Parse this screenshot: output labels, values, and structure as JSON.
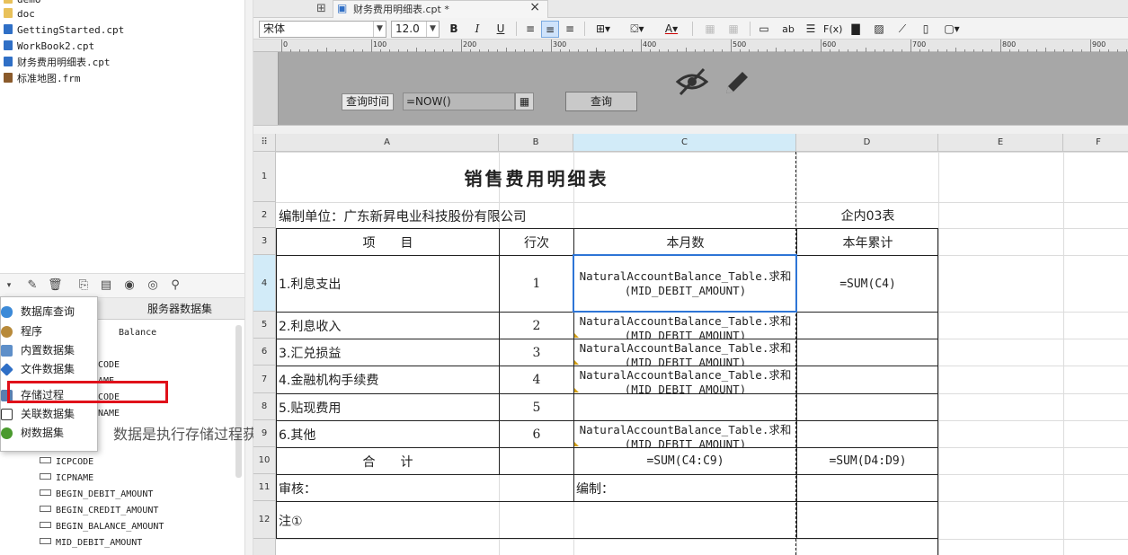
{
  "file_tree": [
    {
      "name": "demo",
      "kind": "folder"
    },
    {
      "name": "doc",
      "kind": "folder"
    },
    {
      "name": "GettingStarted.cpt",
      "kind": "cpt"
    },
    {
      "name": "WorkBook2.cpt",
      "kind": "cpt"
    },
    {
      "name": "财务费用明细表.cpt",
      "kind": "cpt"
    },
    {
      "name": "标准地图.frm",
      "kind": "frm"
    }
  ],
  "dataset_panel": {
    "tabs": [
      "服务器数据集"
    ],
    "partial_items": [
      "Balance",
      "CODE",
      "AME",
      "CODE",
      "NAME"
    ],
    "fields": [
      "ICPCODE",
      "ICPNAME",
      "BEGIN_DEBIT_AMOUNT",
      "BEGIN_CREDIT_AMOUNT",
      "BEGIN_BALANCE_AMOUNT",
      "MID_DEBIT_AMOUNT"
    ]
  },
  "context_menu": {
    "items": [
      "数据库查询",
      "程序",
      "内置数据集",
      "文件数据集",
      "存储过程",
      "关联数据集",
      "树数据集"
    ],
    "highlighted_item": "存储过程"
  },
  "annotation_text": "数据是执行存储过程获取",
  "editor_tab": {
    "title": "财务费用明细表.cpt *",
    "close_symbol": "×"
  },
  "toolbar": {
    "font_name": "宋体",
    "font_size": "12.0",
    "bold": "B",
    "italic": "I",
    "underline": "U",
    "text_ab": "ab",
    "fx": "F(x)"
  },
  "ruler_labels": [
    "0",
    "100",
    "200",
    "300",
    "400",
    "500",
    "600",
    "700",
    "800",
    "900"
  ],
  "param_pane": {
    "label": "查询时间",
    "input_value": "=NOW()",
    "query_button": "查询"
  },
  "columns": [
    "A",
    "B",
    "C",
    "D",
    "E",
    "F"
  ],
  "rows": [
    "1",
    "2",
    "3",
    "4",
    "5",
    "6",
    "7",
    "8",
    "9",
    "10",
    "11",
    "12"
  ],
  "report": {
    "title": "销售费用明细表",
    "unit": "编制单位：广东新昇电业科技股份有限公司",
    "form_no": "企内03表",
    "headers": {
      "item": "项　　目",
      "line": "行次",
      "month": "本月数",
      "year": "本年累计"
    },
    "items": [
      {
        "name": "1.利息支出",
        "line": "1",
        "month": "NaturalAccountBalance_Table.求和(MID_DEBIT_AMOUNT)",
        "year": "=SUM(C4)"
      },
      {
        "name": "2.利息收入",
        "line": "2",
        "month": "NaturalAccountBalance_Table.求和(MID_DEBIT_AMOUNT)",
        "year": ""
      },
      {
        "name": "3.汇兑损益",
        "line": "3",
        "month": "NaturalAccountBalance_Table.求和(MID_DEBIT_AMOUNT)",
        "year": ""
      },
      {
        "name": "4.金融机构手续费",
        "line": "4",
        "month": "NaturalAccountBalance_Table.求和(MID_DEBIT_AMOUNT)",
        "year": ""
      },
      {
        "name": "5.贴现费用",
        "line": "5",
        "month": "",
        "year": ""
      },
      {
        "name": "6.其他",
        "line": "6",
        "month": "NaturalAccountBalance_Table.求和(MID_DEBIT_AMOUNT)",
        "year": ""
      }
    ],
    "total": {
      "label": "合　　计",
      "month": "=SUM(C4:C9)",
      "year": "=SUM(D4:D9)"
    },
    "reviewer": "审核：",
    "preparer": "编制：",
    "note": "注①"
  },
  "colors": {
    "accent": "#2e75d6",
    "highlight": "#e0101a",
    "selected_header": "#d2ebf8"
  }
}
